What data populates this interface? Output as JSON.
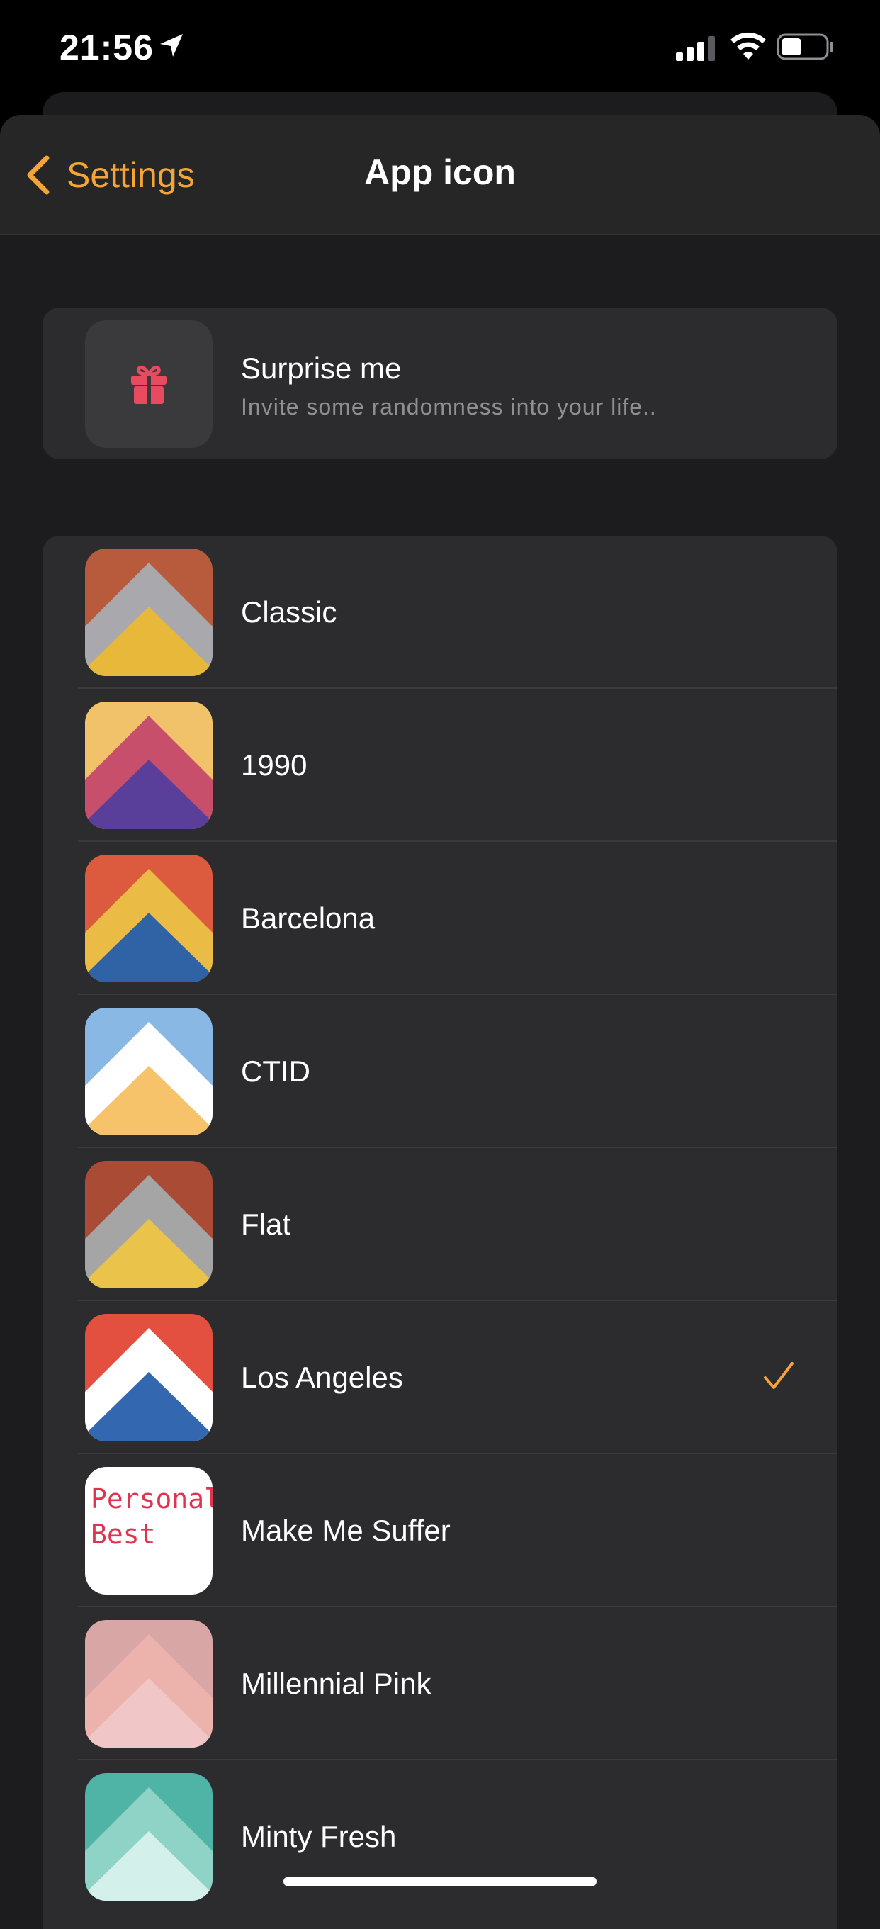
{
  "status_bar": {
    "time": "21:56"
  },
  "nav": {
    "back_label": "Settings",
    "title": "App icon"
  },
  "surprise": {
    "title": "Surprise me",
    "subtitle": "Invite some randomness into your life.."
  },
  "icons": [
    {
      "label": "Classic",
      "selected": false,
      "colors": [
        "#b85a3c",
        "#a9a9ad",
        "#e8b83a"
      ]
    },
    {
      "label": "1990",
      "selected": false,
      "colors": [
        "#f2c26a",
        "#c84f6b",
        "#5a3f9a"
      ]
    },
    {
      "label": "Barcelona",
      "selected": false,
      "colors": [
        "#dc5a3d",
        "#ebbc45",
        "#2f63a6"
      ]
    },
    {
      "label": "CTID",
      "selected": false,
      "colors": [
        "#8ab8e4",
        "#ffffff",
        "#f6c36a"
      ]
    },
    {
      "label": "Flat",
      "selected": false,
      "colors": [
        "#a94b35",
        "#a5a5a5",
        "#e9c34a"
      ]
    },
    {
      "label": "Los Angeles",
      "selected": true,
      "colors": [
        "#e4503f",
        "#ffffff",
        "#3367b0"
      ]
    },
    {
      "label": "Make Me Suffer",
      "selected": false,
      "thumb_text": [
        "Personal",
        "Best"
      ],
      "colors": [
        "#ffffff",
        "#e0334f"
      ]
    },
    {
      "label": "Millennial Pink",
      "selected": false,
      "colors": [
        "#d8a7a5",
        "#ebb3ab",
        "#f0c7c6"
      ]
    },
    {
      "label": "Minty Fresh",
      "selected": false,
      "colors": [
        "#4fb3a5",
        "#8ed3c6",
        "#d4f0ea"
      ]
    }
  ],
  "accent_color": "#f5a537",
  "icon_names": {
    "location": "location-arrow-icon",
    "signal": "cellular-signal-icon",
    "wifi": "wifi-icon",
    "battery": "battery-icon",
    "back": "chevron-left-icon",
    "gift": "gift-icon",
    "check": "checkmark-icon"
  }
}
